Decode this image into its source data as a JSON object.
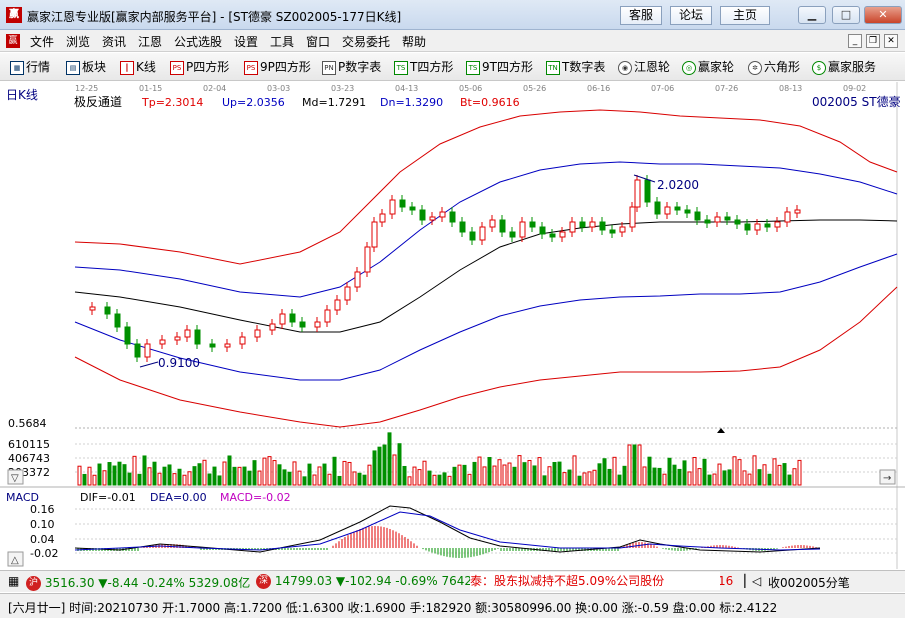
{
  "window": {
    "title": "赢家江恩专业版[赢家内部服务平台] - [ST德豪  SZ002005-177日K线]",
    "top_buttons": [
      "客服",
      "论坛",
      "主页"
    ]
  },
  "menu": {
    "items": [
      "文件",
      "浏览",
      "资讯",
      "江恩",
      "公式选股",
      "设置",
      "工具",
      "窗口",
      "交易委托",
      "帮助"
    ]
  },
  "toolbar": {
    "items": [
      "行情",
      "板块",
      "K线",
      "P四方形",
      "9P四方形",
      "P数字表",
      "T四方形",
      "9T四方形",
      "T数字表",
      "江恩轮",
      "赢家轮",
      "六角形",
      "赢家服务"
    ],
    "icon_texts": [
      "PS",
      "PS",
      "PN",
      "TS",
      "TS",
      "TN"
    ]
  },
  "chart": {
    "period_label": "日K线",
    "date_ticks": [
      "12-25",
      "01-15",
      "02-04",
      "03-03",
      "03-23",
      "04-13",
      "05-06",
      "05-26",
      "06-16",
      "07-06",
      "07-26",
      "08-13",
      "09-02"
    ],
    "indicator_name": "极反通道",
    "tp": "Tp=2.3014",
    "up": "Up=2.0356",
    "md": "Md=1.7291",
    "dn": "Dn=1.3290",
    "bt": "Bt=0.9616",
    "stock_label": "002005  ST德豪",
    "high_label": "2.0200",
    "low_label": "0.9100",
    "volume_ticks": [
      "0.5684",
      "610115",
      "406743",
      "203372"
    ],
    "macd_title": "MACD",
    "dif": "DIF=-0.01",
    "dea": "DEA=0.00",
    "macd": "MACD=-0.02",
    "macd_ticks": [
      "0.16",
      "0.10",
      "0.04",
      "-0.02"
    ],
    "colors": {
      "up": "#e00000",
      "down": "#009000",
      "band_outer": "#d80000",
      "band_inner": "#0000c0",
      "mid": "#000000",
      "text_blue": "#000080"
    }
  },
  "ticker": {
    "sh_badge": "沪",
    "sh_text": "3516.30 ▼-8.44 -0.24% 5329.08亿",
    "sz_badge": "深",
    "sz_text": "14799.03 ▼-102.94 -0.69% 7642.8",
    "news": "泰：股东拟减持不超5.09%公司股份",
    "news_num": "16",
    "closing": "收002005分笔"
  },
  "infobar": {
    "text": "[六月廿一] 时间:20210730 开:1.7000 高:1.7200 低:1.6300 收:1.6900 手:182920 额:30580996.00 换:0.00 涨:-0.59 盘:0.00 标:2.4122"
  }
}
